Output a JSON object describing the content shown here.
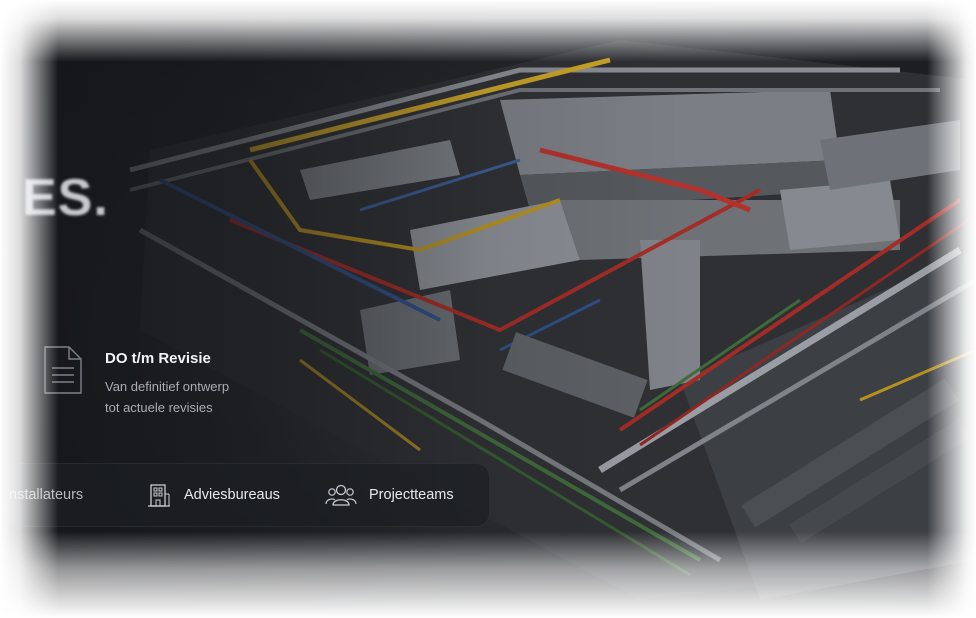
{
  "hero": {
    "headline_fragment": "ES.",
    "feature": {
      "icon": "document-icon",
      "title": "DO t/m Revisie",
      "description_line1": "Van definitief ontwerp",
      "description_line2": "tot actuele revisies"
    },
    "audiences": [
      {
        "label": "Installateurs",
        "visible_text": "nstallateurs",
        "icon": "none"
      },
      {
        "label": "Adviesbureaus",
        "icon": "building-icon"
      },
      {
        "label": "Projectteams",
        "icon": "users-icon"
      }
    ]
  },
  "colors": {
    "pipe_yellow": "#c9a227",
    "pipe_red": "#a42c26",
    "pipe_blue": "#2f4f86",
    "pipe_green": "#3f6b3a",
    "duct_grey": "#8d9196",
    "text_primary": "#f2f3f5",
    "text_muted": "#a9adb4"
  }
}
